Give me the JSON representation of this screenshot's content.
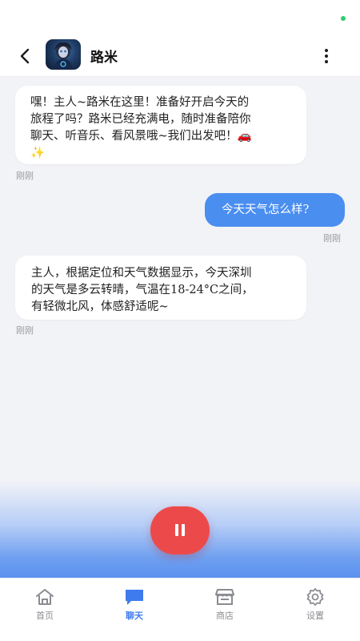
{
  "header": {
    "title": "路米",
    "back_icon": "chevron-left-icon",
    "more_icon": "more-vertical-icon"
  },
  "messages": [
    {
      "role": "assistant",
      "lines": [
        "嘿！主人~路米在这里！准备好开启今天的",
        "旅程了吗？路米已经充满电，随时准备陪你",
        "聊天、听音乐、看风景哦~我们出发吧！🚗",
        "✨"
      ],
      "time": "刚刚"
    },
    {
      "role": "user",
      "lines": [
        "今天天气怎么样?"
      ],
      "time": "刚刚"
    },
    {
      "role": "assistant",
      "lines": [
        "主人，根据定位和天气数据显示，今天深圳",
        "的天气是多云转晴，气温在18-24°C之间，",
        "有轻微北风，体感舒适呢~"
      ],
      "time": "刚刚"
    }
  ],
  "controls": {
    "pause_icon": "pause-icon",
    "pause_color": "#ec4a4a"
  },
  "tabbar": {
    "items": [
      {
        "label": "首页",
        "icon": "home-icon",
        "active": false
      },
      {
        "label": "聊天",
        "icon": "chat-icon",
        "active": true
      },
      {
        "label": "商店",
        "icon": "store-icon",
        "active": false
      },
      {
        "label": "设置",
        "icon": "gear-icon",
        "active": false
      }
    ],
    "active_color": "#3e7bee"
  },
  "colors": {
    "user_bubble": "#4a8ef0",
    "status_indicator": "#2ecc71"
  }
}
